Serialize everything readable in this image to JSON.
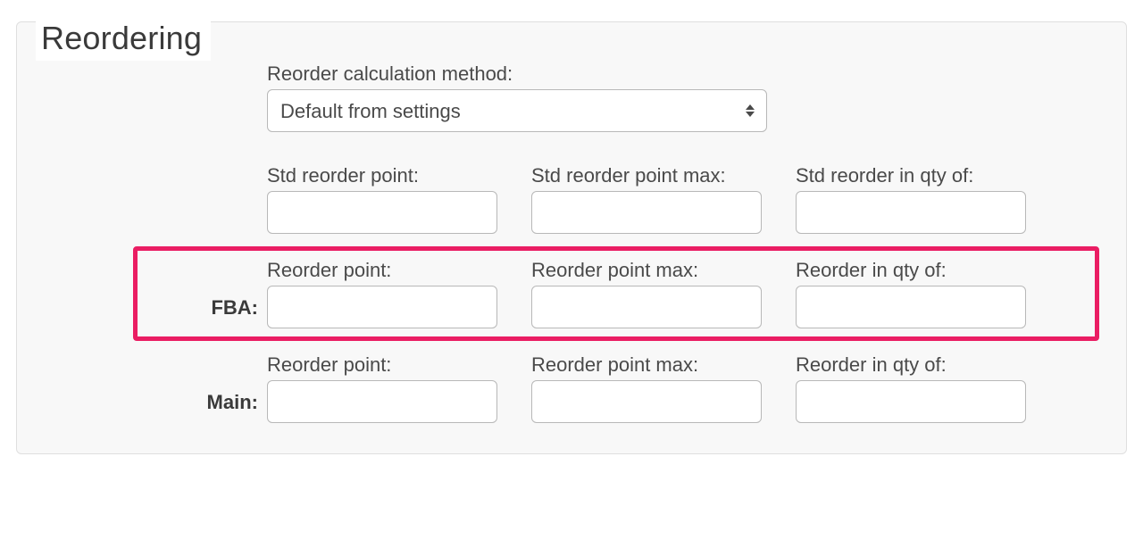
{
  "section": {
    "title": "Reordering"
  },
  "method": {
    "label": "Reorder calculation method:",
    "selected": "Default from settings",
    "options": [
      "Default from settings"
    ]
  },
  "std_row": {
    "fields": [
      {
        "label": "Std reorder point:",
        "value": ""
      },
      {
        "label": "Std reorder point max:",
        "value": ""
      },
      {
        "label": "Std reorder in qty of:",
        "value": ""
      }
    ]
  },
  "location_rows": [
    {
      "name": "FBA:",
      "highlighted": true,
      "fields": [
        {
          "label": "Reorder point:",
          "value": ""
        },
        {
          "label": "Reorder point max:",
          "value": ""
        },
        {
          "label": "Reorder in qty of:",
          "value": ""
        }
      ]
    },
    {
      "name": "Main:",
      "highlighted": false,
      "fields": [
        {
          "label": "Reorder point:",
          "value": ""
        },
        {
          "label": "Reorder point max:",
          "value": ""
        },
        {
          "label": "Reorder in qty of:",
          "value": ""
        }
      ]
    }
  ]
}
